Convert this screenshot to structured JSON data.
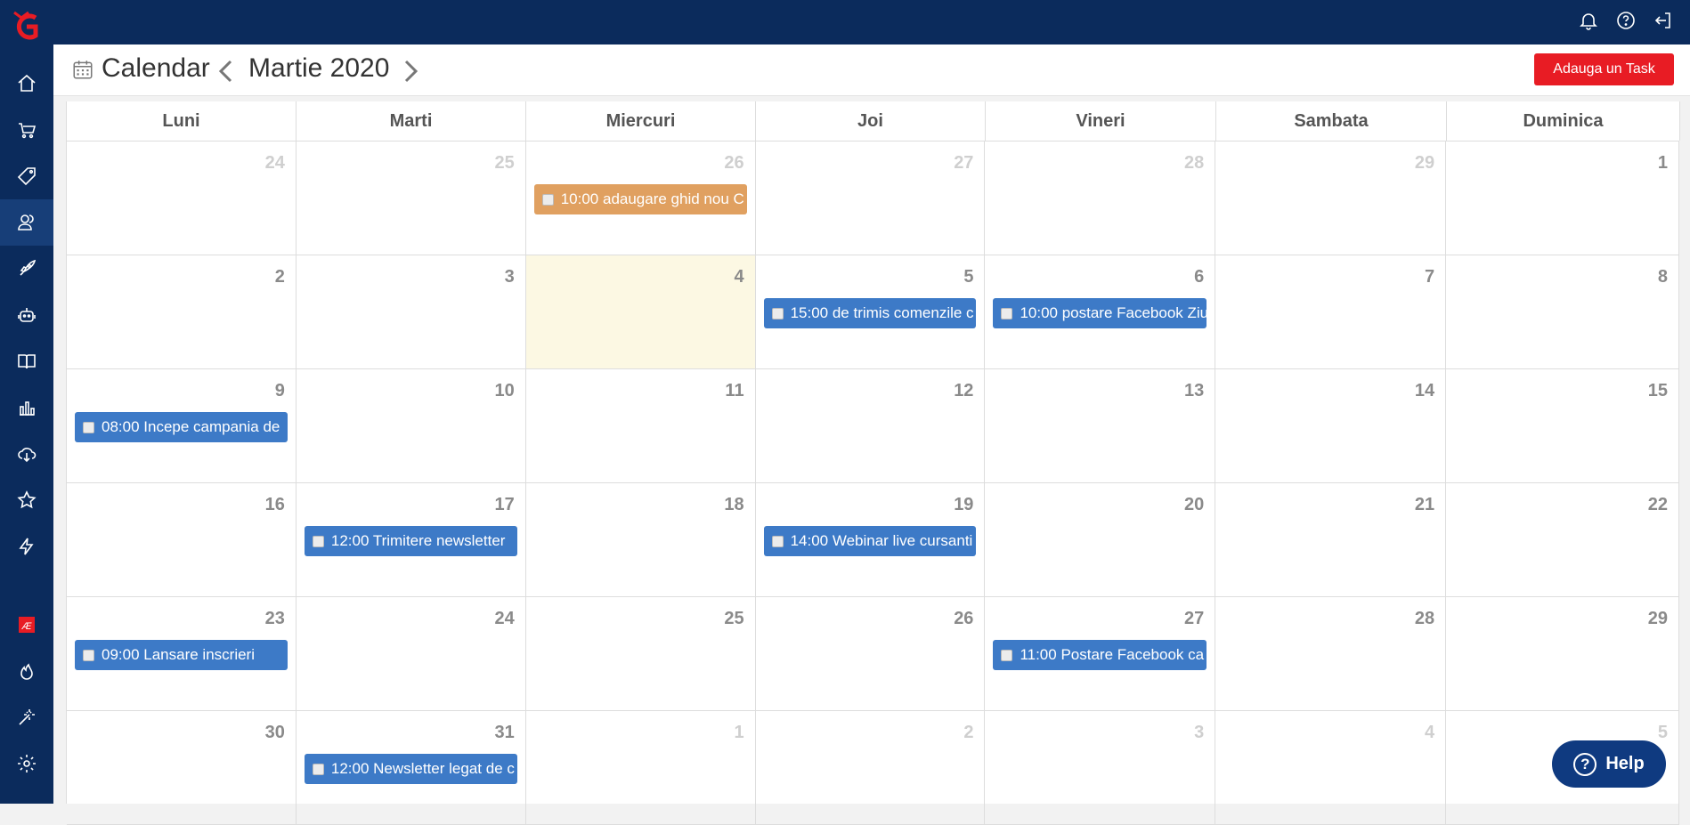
{
  "colors": {
    "nav_bg": "#0b2b5c",
    "event_blue": "#3d7ac7",
    "event_orange": "#e0a060",
    "add_button": "#e81c24",
    "today_bg": "#fcf8e3"
  },
  "sidebar": {
    "icons": [
      "home-icon",
      "cart-icon",
      "tag-icon",
      "users-icon",
      "rocket-icon",
      "robot-icon",
      "book-icon",
      "chart-icon",
      "cloud-download-icon",
      "star-icon",
      "lightning-icon",
      "ae-logo-icon",
      "fire-icon",
      "magic-wand-icon",
      "settings-icon"
    ],
    "active": "users-icon"
  },
  "topbar": {
    "icons": [
      "bell-icon",
      "help-circle-icon",
      "logout-icon"
    ]
  },
  "header": {
    "title": "Calendar",
    "month": "Martie 2020",
    "add_button": "Adauga un Task"
  },
  "calendar": {
    "weekdays": [
      "Luni",
      "Marti",
      "Miercuri",
      "Joi",
      "Vineri",
      "Sambata",
      "Duminica"
    ],
    "weeks": [
      [
        "24",
        "25",
        "26",
        "27",
        "28",
        "29",
        "1"
      ],
      [
        "2",
        "3",
        "4",
        "5",
        "6",
        "7",
        "8"
      ],
      [
        "9",
        "10",
        "11",
        "12",
        "13",
        "14",
        "15"
      ],
      [
        "16",
        "17",
        "18",
        "19",
        "20",
        "21",
        "22"
      ],
      [
        "23",
        "24",
        "25",
        "26",
        "27",
        "28",
        "29"
      ],
      [
        "30",
        "31",
        "1",
        "2",
        "3",
        "4",
        "5"
      ]
    ],
    "events": {
      "w0d2": "10:00 adaugare ghid nou C",
      "w1d3": "15:00 de trimis comenzile c",
      "w1d4": "10:00 postare Facebook Ziu",
      "w2d0": "08:00 Incepe campania de",
      "w3d1": "12:00 Trimitere newsletter",
      "w3d3": "14:00 Webinar live cursanti",
      "w4d0": "09:00 Lansare inscrieri",
      "w4d4": "11:00 Postare Facebook ca",
      "w5d1": "12:00 Newsletter legat de c"
    }
  },
  "help": {
    "label": "Help"
  }
}
